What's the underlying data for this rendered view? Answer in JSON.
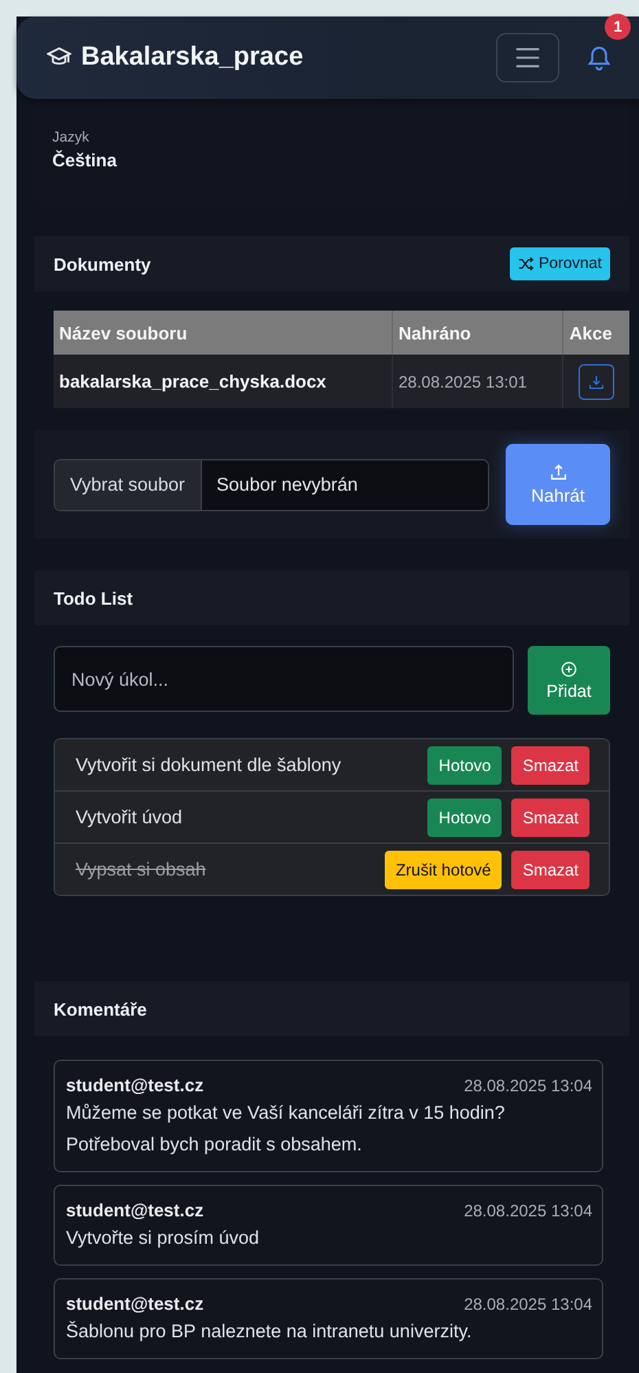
{
  "header": {
    "title": "Bakalarska_prace",
    "notification_count": "1"
  },
  "language": {
    "label": "Jazyk",
    "value": "Čeština"
  },
  "documents": {
    "title": "Dokumenty",
    "compare_button": "Porovnat",
    "table": {
      "columns": [
        "Název souboru",
        "Nahráno",
        "Akce"
      ],
      "rows": [
        {
          "name": "bakalarska_prace_chyska.docx",
          "uploaded": "28.08.2025 13:01"
        }
      ]
    },
    "upload": {
      "choose_button": "Vybrat soubor",
      "file_status": "Soubor nevybrán",
      "upload_button": "Nahrát"
    }
  },
  "todo": {
    "title": "Todo List",
    "placeholder": "Nový úkol...",
    "add_button": "Přidat",
    "items": [
      {
        "text": "Vytvořit si dokument dle šablony",
        "done": false,
        "toggle_button": "Hotovo",
        "delete_button": "Smazat"
      },
      {
        "text": "Vytvořit úvod",
        "done": false,
        "toggle_button": "Hotovo",
        "delete_button": "Smazat"
      },
      {
        "text": "Vypsat si obsah",
        "done": true,
        "toggle_button": "Zrušit hotové",
        "delete_button": "Smazat"
      }
    ]
  },
  "comments": {
    "title": "Komentáře",
    "items": [
      {
        "author": "student@test.cz",
        "date": "28.08.2025 13:04",
        "text": "Můžeme se potkat ve Vaší kanceláři zítra v 15 hodin? Potřeboval bych poradit s obsahem."
      },
      {
        "author": "student@test.cz",
        "date": "28.08.2025 13:04",
        "text": "Vytvořte si prosím úvod"
      },
      {
        "author": "student@test.cz",
        "date": "28.08.2025 13:04",
        "text": "Šablonu pro BP naleznete na intranetu univerzity."
      }
    ]
  }
}
